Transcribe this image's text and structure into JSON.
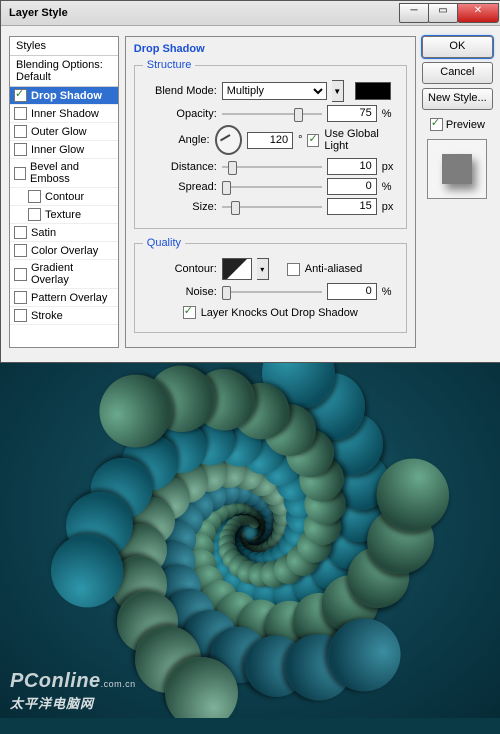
{
  "window": {
    "title": "Layer Style"
  },
  "styles": {
    "header": "Styles",
    "blending": "Blending Options: Default",
    "items": [
      {
        "label": "Drop Shadow",
        "checked": true,
        "selected": true
      },
      {
        "label": "Inner Shadow",
        "checked": false
      },
      {
        "label": "Outer Glow",
        "checked": false
      },
      {
        "label": "Inner Glow",
        "checked": false
      },
      {
        "label": "Bevel and Emboss",
        "checked": false
      },
      {
        "label": "Contour",
        "checked": false,
        "indent": true
      },
      {
        "label": "Texture",
        "checked": false,
        "indent": true
      },
      {
        "label": "Satin",
        "checked": false
      },
      {
        "label": "Color Overlay",
        "checked": false
      },
      {
        "label": "Gradient Overlay",
        "checked": false
      },
      {
        "label": "Pattern Overlay",
        "checked": false
      },
      {
        "label": "Stroke",
        "checked": false
      }
    ]
  },
  "panel": {
    "title": "Drop Shadow",
    "structure": {
      "legend": "Structure",
      "blend_lbl": "Blend Mode:",
      "blend_val": "Multiply",
      "shadow_color": "#000000",
      "opacity_lbl": "Opacity:",
      "opacity_val": "75",
      "pct": "%",
      "angle_lbl": "Angle:",
      "angle_val": "120",
      "deg": "°",
      "global_lbl": "Use Global Light",
      "global_on": true,
      "distance_lbl": "Distance:",
      "distance_val": "10",
      "px": "px",
      "spread_lbl": "Spread:",
      "spread_val": "0",
      "size_lbl": "Size:",
      "size_val": "15"
    },
    "quality": {
      "legend": "Quality",
      "contour_lbl": "Contour:",
      "aa_lbl": "Anti-aliased",
      "aa_on": false,
      "noise_lbl": "Noise:",
      "noise_val": "0",
      "knock_lbl": "Layer Knocks Out Drop Shadow",
      "knock_on": true
    }
  },
  "right": {
    "ok": "OK",
    "cancel": "Cancel",
    "new": "New Style...",
    "preview_lbl": "Preview",
    "preview_on": true
  },
  "watermark": {
    "brand": "PConline",
    "suffix": ".com.cn",
    "cn": "太平洋电脑网"
  }
}
